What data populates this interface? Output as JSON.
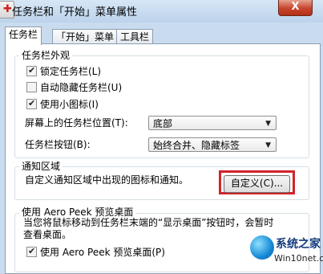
{
  "window": {
    "title": "任务栏和「开始」菜单属性",
    "close_label": "X"
  },
  "tabs": [
    {
      "label": "任务栏",
      "active": true
    },
    {
      "label": "「开始」菜单",
      "active": false
    },
    {
      "label": "工具栏",
      "active": false
    }
  ],
  "appearance": {
    "title": "任务栏外观",
    "checkboxes": [
      {
        "label": "锁定任务栏(L)",
        "checked": true
      },
      {
        "label": "自动隐藏任务栏(U)",
        "checked": false
      },
      {
        "label": "使用小图标(I)",
        "checked": true
      }
    ],
    "location_label": "屏幕上的任务栏位置(T):",
    "location_value": "底部",
    "buttons_label": "任务栏按钮(B):",
    "buttons_value": "始终合并、隐藏标签"
  },
  "notify": {
    "title": "通知区域",
    "description": "自定义通知区域中出现的图标和通知。",
    "customize_label": "自定义(C)..."
  },
  "peek": {
    "title": "使用 Aero Peek 预览桌面",
    "description_line1": "当您将鼠标移动到任务栏末端的“显示桌面”按钮时，会暂时",
    "description_line2": "查看桌面。",
    "checkbox_label": "使用 Aero Peek 预览桌面(P)",
    "checkbox_checked": true
  },
  "watermark": {
    "name": "系统之家",
    "url": "Win10net.com"
  },
  "colors": {
    "highlight": "#d2232a",
    "window_frame": "#c9dcef"
  }
}
